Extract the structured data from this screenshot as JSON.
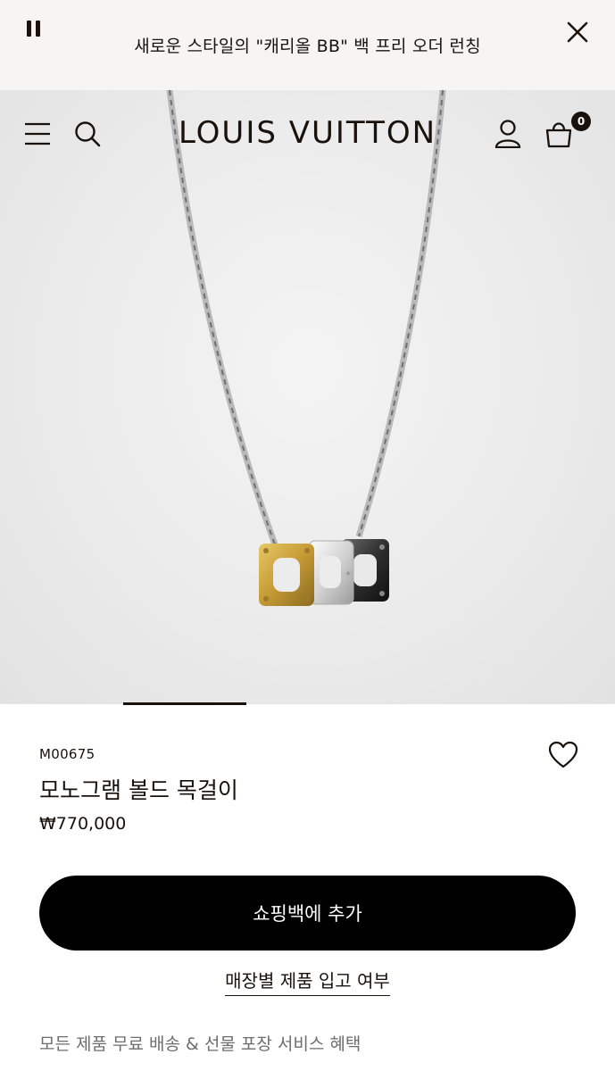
{
  "announcement": {
    "text": "새로운 스타일의 \"캐리올 BB\" 백 프리 오더 런칭",
    "pause_icon": "pause-icon",
    "close_icon": "close-icon"
  },
  "header": {
    "brand": "LOUIS VUITTON",
    "cart_count": "0",
    "icons": [
      "menu-icon",
      "search-icon",
      "account-icon",
      "shopping-bag-icon"
    ]
  },
  "carousel": {
    "active_index": 2,
    "total": 5
  },
  "product": {
    "sku": "M00675",
    "name": "모노그램 볼드 목걸이",
    "price": "₩770,000",
    "add_to_bag": "쇼핑백에 추가",
    "store_stock": "매장별 제품 입고 여부",
    "perks": "모든 제품 무료 배송 & 선물 포장 서비스 혜택"
  },
  "colors": {
    "brand_dark": "#19110b",
    "cta_bg": "#000000",
    "announce_bg": "#f6f5f3",
    "muted_text": "#6d6d6d"
  }
}
